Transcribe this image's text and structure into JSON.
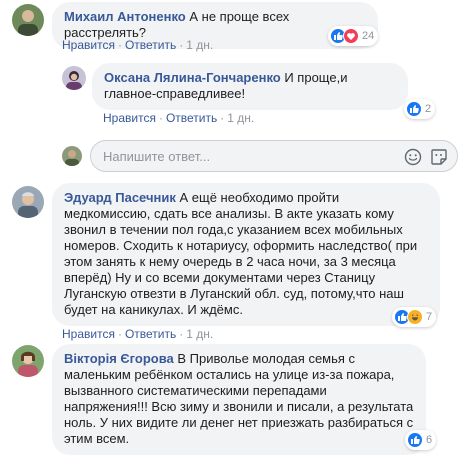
{
  "colors": {
    "link": "#385898",
    "meta": "#90949c",
    "bubble": "#f2f3f5",
    "like": "#1877f2",
    "love": "#f33e58",
    "haha": "#f7b125"
  },
  "comments": [
    {
      "author": "Михаил Антоненко",
      "text": "А не проще всех расстрелять?",
      "like_label": "Нравится",
      "reply_label": "Ответить",
      "time": "1 дн.",
      "reactions": [
        "like-icon",
        "love-icon"
      ],
      "reaction_count": "24"
    },
    {
      "author": "Оксана Лялина-Гончаренко",
      "text": "И проще,и главное-справедливее!",
      "like_label": "Нравится",
      "reply_label": "Ответить",
      "time": "1 дн.",
      "reactions": [
        "like-icon"
      ],
      "reaction_count": "2"
    },
    {
      "author": "Эдуард Пасечник",
      "text": "А ещё необходимо пройти медкомиссию, сдать все анализы. В акте указать кому звонил в течении пол года,с указанием всех мобильных номеров. Сходить к нотариусу, оформить наследство( при этом занять к нему очередь в 2 часа ночи, за 3 месяца вперёд) Ну и со всеми документами через Станицу Луганскую отвезти в Луганский обл. суд, потому,что наш будет на каникулах. И ждёмс.",
      "like_label": "Нравится",
      "reply_label": "Ответить",
      "time": "1 дн.",
      "reactions": [
        "like-icon",
        "haha-icon"
      ],
      "reaction_count": "7"
    },
    {
      "author": "Вікторія Єгорова",
      "text": "В Приволье молодая семья с маленьким ребёнком остались на улице из-за пожара, вызванного систематическими перепадами напряжения!!! Всю зиму и звонили и писали, а результата ноль. У них видите ли денег нет приезжать разбираться с этим всем.",
      "like_label": "Нравится",
      "reply_label": "Ответить",
      "time": "1 дн.",
      "reactions": [
        "like-icon"
      ],
      "reaction_count": "6"
    }
  ],
  "reply_input": {
    "placeholder": "Напишите ответ..."
  }
}
